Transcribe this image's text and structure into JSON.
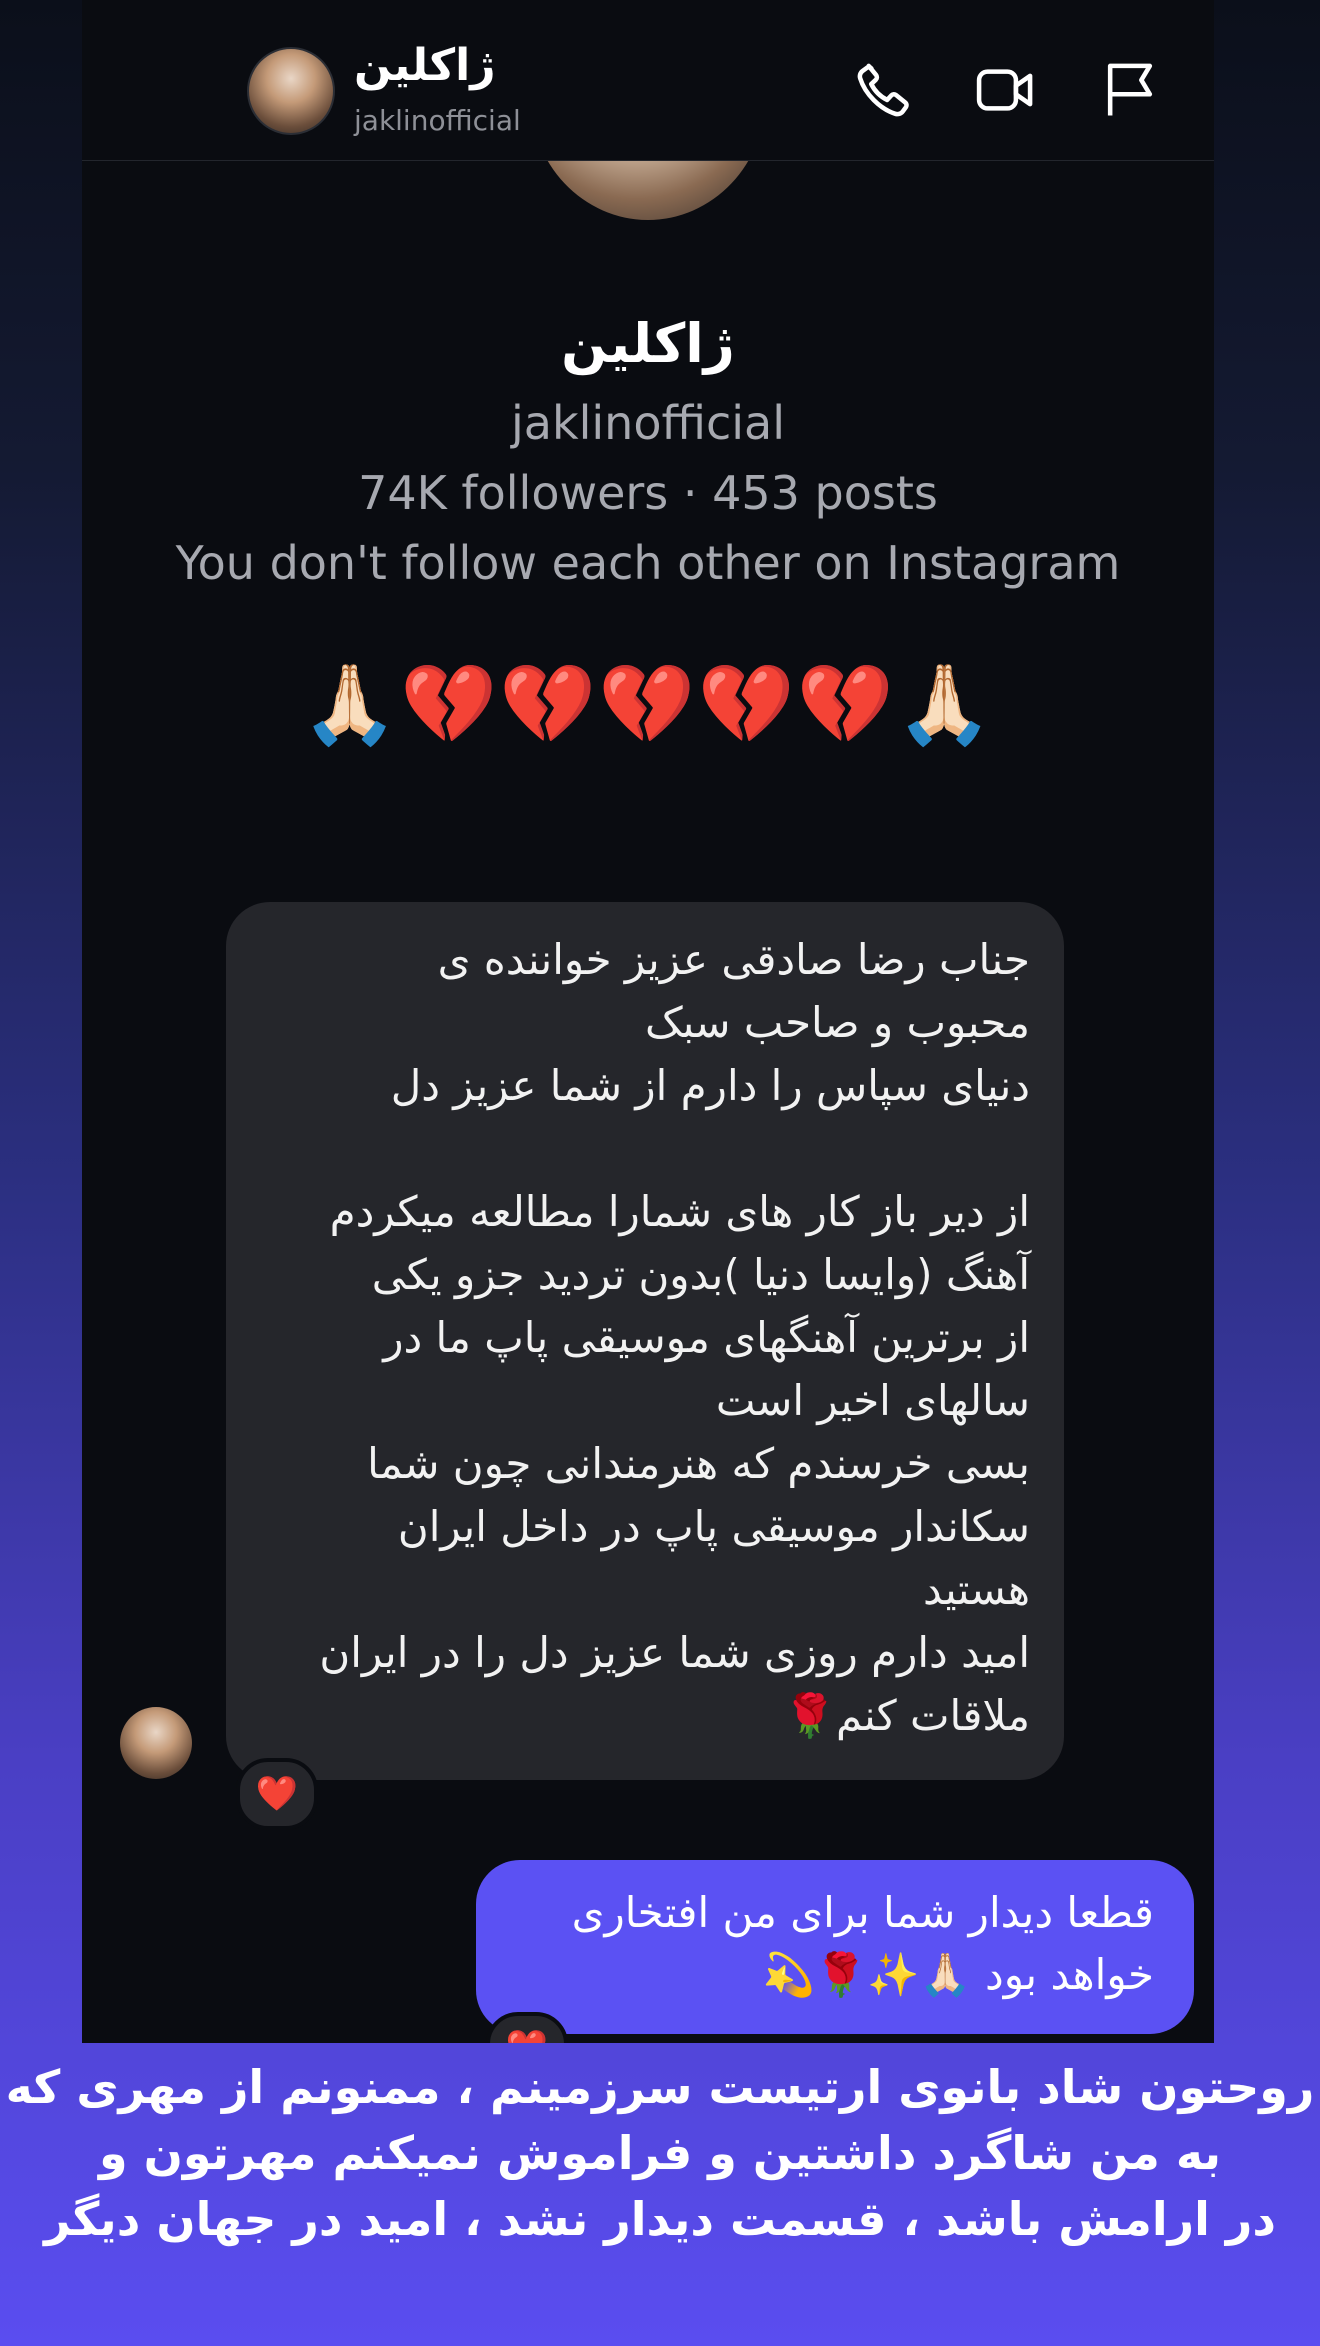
{
  "header": {
    "name": "ژاکلین",
    "username": "jaklinofficial",
    "icons": [
      "phone-icon",
      "video-icon",
      "flag-icon"
    ]
  },
  "profile": {
    "name": "ژاکلین",
    "username": "jaklinofficial",
    "stats": "74K followers · 453 posts",
    "follow_status": "You don't follow each other on Instagram"
  },
  "first_message": "🙏🏻💔💔💔💔💔🙏🏻",
  "incoming_message": {
    "lines": [
      "جناب رضا صادقی عزیز  خواننده ی",
      "محبوب و صاحب سبک",
      "دنیای سپاس را دارم از شما عزیز دل",
      "",
      "از دیر باز کار های شمارا مطالعه میکردم",
      "آهنگ (وایسا دنیا )بدون تردید  جزو یکی",
      "از  برترین آهنگهای  موسیقی پاپ ما در",
      "سالهای اخیر است",
      "بسی خرسندم که هنرمندانی چون شما",
      "سکاندار موسیقی پاپ در داخل ایران",
      "هستید",
      "امید دارم روزی شما عزیز دل را در ایران",
      "ملاقات کنم🌹"
    ],
    "reaction": "❤️"
  },
  "outgoing_message": {
    "lines": [
      "قطعا دیدار شما برای من افتخاری",
      "خواهد بود 🙏🏻✨🌹💫"
    ],
    "reaction": "❤️"
  },
  "caption": {
    "lines": [
      "روحتون شاد بانوی ارتیست سرزمینم ، ممنونم از مهری که",
      "به من شاگرد داشتین و فراموش نمیکنم مهرتون و",
      "در ارامش باشد ، قسمت دیدار نشد ، امید در جهان دیگر"
    ]
  },
  "colors": {
    "chat_bg": "#0a0c11",
    "incoming_bubble": "#25262b",
    "outgoing_bubble": "#5b51f3",
    "muted_text": "#a7a9b0"
  }
}
